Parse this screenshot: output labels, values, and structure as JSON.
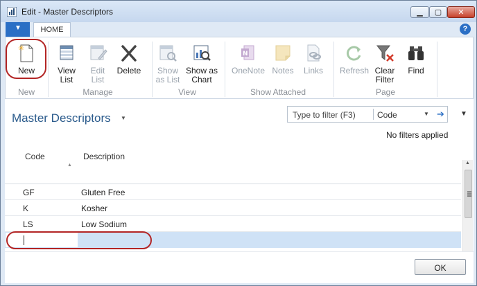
{
  "window": {
    "title": "Edit - Master Descriptors"
  },
  "tabs": {
    "home": "HOME",
    "help": "?"
  },
  "ribbon": {
    "new": "New",
    "view_list": [
      "View",
      "List"
    ],
    "edit_list": [
      "Edit",
      "List"
    ],
    "delete": "Delete",
    "show_as_list": [
      "Show",
      "as List"
    ],
    "show_as_chart": [
      "Show as",
      "Chart"
    ],
    "onenote": "OneNote",
    "notes": "Notes",
    "links": "Links",
    "refresh": "Refresh",
    "clear_filter": [
      "Clear",
      "Filter"
    ],
    "find": "Find",
    "groups": {
      "new": "New",
      "manage": "Manage",
      "view": "View",
      "show_attached": "Show Attached",
      "page": "Page"
    }
  },
  "page": {
    "title": "Master Descriptors",
    "filter": {
      "placeholder": "Type to filter (F3)",
      "field": "Code"
    },
    "no_filters": "No filters applied"
  },
  "table": {
    "headers": {
      "code": "Code",
      "description": "Description"
    },
    "rows": [
      {
        "code": "GF",
        "description": "Gluten Free"
      },
      {
        "code": "K",
        "description": "Kosher"
      },
      {
        "code": "LS",
        "description": "Low Sodium"
      }
    ]
  },
  "footer": {
    "ok": "OK"
  },
  "colors": {
    "accent": "#2b6fc5",
    "title": "#2b5b8c",
    "highlight": "#b32525",
    "selected_row": "#cfe2f6"
  }
}
